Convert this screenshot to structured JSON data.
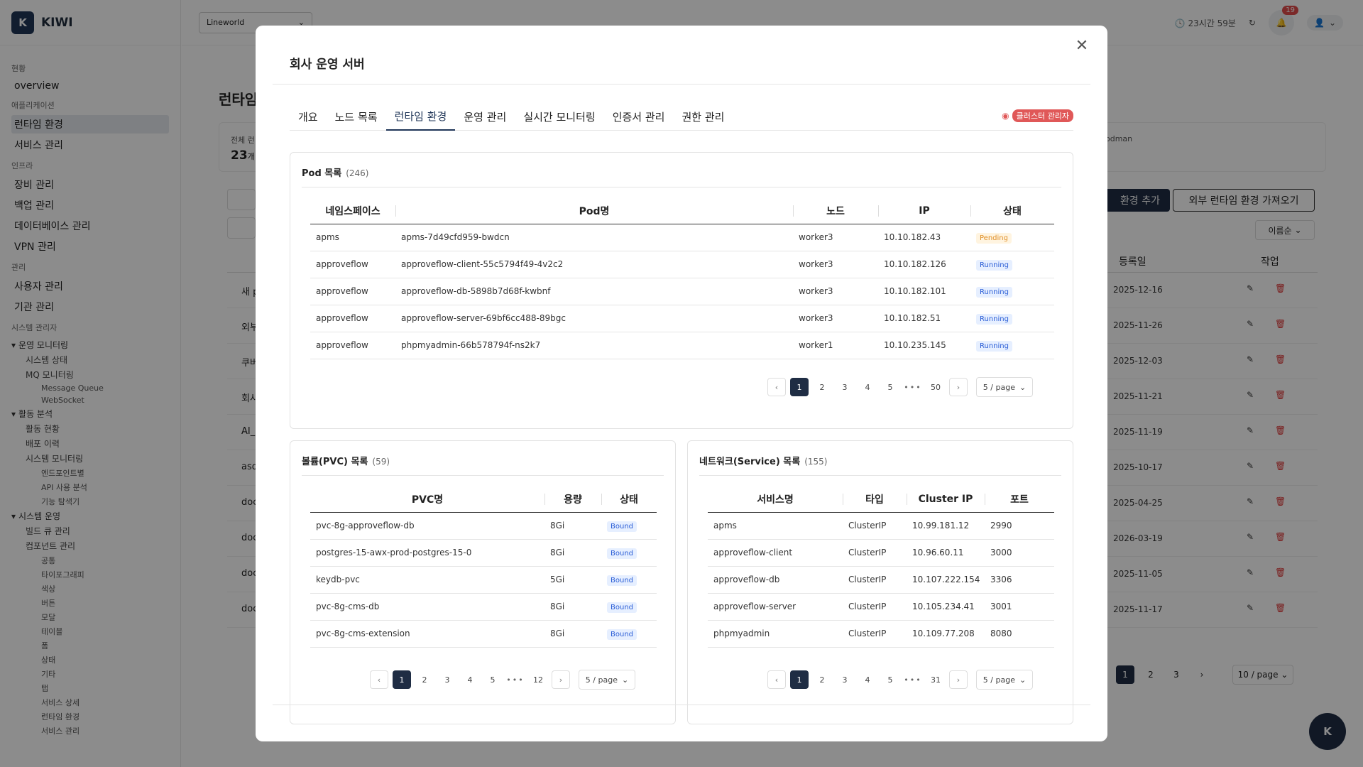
{
  "app": {
    "logo_letter": "K",
    "logo_text": "KIWI",
    "project_select": "Lineworld",
    "session_timer": "23시간 59분",
    "notification_count": "19",
    "page_title": "런타임",
    "stat_label": "전체 런",
    "stat_value": "23",
    "stat_unit": "개",
    "stat_right_text": "odman",
    "add_button": "환경 추가",
    "import_button": "외부 런타임 환경 가져오기",
    "sort_label": "이름순",
    "col_registered": "등록일",
    "col_actions": "작업",
    "fab_label": "K"
  },
  "sidebar": {
    "groups": [
      {
        "title": "현황",
        "items": [
          {
            "label": "overview"
          }
        ]
      },
      {
        "title": "애플리케이션",
        "items": [
          {
            "label": "런타임 환경",
            "active": true
          },
          {
            "label": "서비스 관리"
          }
        ]
      },
      {
        "title": "인프라",
        "items": [
          {
            "label": "장비 관리"
          },
          {
            "label": "백업 관리"
          },
          {
            "label": "데이터베이스 관리"
          },
          {
            "label": "VPN 관리"
          }
        ]
      },
      {
        "title": "관리",
        "items": [
          {
            "label": "사용자 관리"
          },
          {
            "label": "기관 관리"
          }
        ]
      },
      {
        "title": "시스템 관리자",
        "items": []
      }
    ],
    "tree": [
      {
        "label": "운영 모니터링",
        "level": 1
      },
      {
        "label": "시스템 상태",
        "level": 2
      },
      {
        "label": "MQ 모니터링",
        "level": 2
      },
      {
        "label": "Message Queue",
        "level": 3
      },
      {
        "label": "WebSocket",
        "level": 3
      },
      {
        "label": "활동 분석",
        "level": 1
      },
      {
        "label": "활동 현황",
        "level": 2
      },
      {
        "label": "배포 이력",
        "level": 2
      },
      {
        "label": "시스템 모니터링",
        "level": 2
      },
      {
        "label": "엔드포인트별",
        "level": 3
      },
      {
        "label": "API 사용 분석",
        "level": 3
      },
      {
        "label": "기능 탐색기",
        "level": 3
      },
      {
        "label": "시스템 운영",
        "level": 1
      },
      {
        "label": "빌드 큐 관리",
        "level": 2
      },
      {
        "label": "컴포넌트 관리",
        "level": 2
      },
      {
        "label": "공통",
        "level": 3
      },
      {
        "label": "타이포그래피",
        "level": 3
      },
      {
        "label": "색상",
        "level": 3
      },
      {
        "label": "버튼",
        "level": 3
      },
      {
        "label": "모달",
        "level": 3
      },
      {
        "label": "테이블",
        "level": 3
      },
      {
        "label": "폼",
        "level": 3
      },
      {
        "label": "상태",
        "level": 3
      },
      {
        "label": "기타",
        "level": 3
      },
      {
        "label": "탭",
        "level": 3
      },
      {
        "label": "서비스 상세",
        "level": 3
      },
      {
        "label": "런타임 환경",
        "level": 3
      },
      {
        "label": "서비스 관리",
        "level": 3
      }
    ]
  },
  "bg_rows": [
    {
      "name": "새 p",
      "date": "2025-12-16"
    },
    {
      "name": "외부",
      "date": "2025-11-26"
    },
    {
      "name": "쿠버",
      "date": "2025-12-03"
    },
    {
      "name": "회사",
      "date": "2025-11-21"
    },
    {
      "name": "AI_c",
      "date": "2025-11-19"
    },
    {
      "name": "asd",
      "date": "2025-10-17"
    },
    {
      "name": "doc",
      "date": "2025-04-25"
    },
    {
      "name": "doc",
      "date": "2026-03-19"
    },
    {
      "name": "doc",
      "date": "2025-11-05"
    },
    {
      "name": "doc",
      "date": "2025-11-17"
    }
  ],
  "bg_pager": {
    "pages": [
      "1",
      "2",
      "3"
    ],
    "size": "10 / page"
  },
  "modal": {
    "title": "회사 운영 서버",
    "tabs": [
      "개요",
      "노드 목록",
      "런타임 환경",
      "운영 관리",
      "실시간 모니터링",
      "인증서 관리",
      "권한 관리"
    ],
    "active_tab": 2,
    "role_badge": "클러스터 관리자"
  },
  "pods": {
    "title": "Pod 목록",
    "count": "(246)",
    "headers": [
      "네임스페이스",
      "Pod명",
      "노드",
      "IP",
      "상태"
    ],
    "rows": [
      {
        "ns": "apms",
        "name": "apms-7d49cfd959-bwdcn",
        "node": "worker3",
        "ip": "10.10.182.43",
        "status": "Pending"
      },
      {
        "ns": "approveflow",
        "name": "approveflow-client-55c5794f49-4v2c2",
        "node": "worker3",
        "ip": "10.10.182.126",
        "status": "Running"
      },
      {
        "ns": "approveflow",
        "name": "approveflow-db-5898b7d68f-kwbnf",
        "node": "worker3",
        "ip": "10.10.182.101",
        "status": "Running"
      },
      {
        "ns": "approveflow",
        "name": "approveflow-server-69bf6cc488-89bgc",
        "node": "worker3",
        "ip": "10.10.182.51",
        "status": "Running"
      },
      {
        "ns": "approveflow",
        "name": "phpmyadmin-66b578794f-ns2k7",
        "node": "worker1",
        "ip": "10.10.235.145",
        "status": "Running"
      }
    ],
    "pager": {
      "pages": [
        "1",
        "2",
        "3",
        "4",
        "5"
      ],
      "last": "50",
      "size": "5 / page"
    }
  },
  "pvcs": {
    "title": "볼륨(PVC) 목록",
    "count": "(59)",
    "headers": [
      "PVC명",
      "용량",
      "상태"
    ],
    "rows": [
      {
        "name": "pvc-8g-approveflow-db",
        "size": "8Gi",
        "status": "Bound"
      },
      {
        "name": "postgres-15-awx-prod-postgres-15-0",
        "size": "8Gi",
        "status": "Bound"
      },
      {
        "name": "keydb-pvc",
        "size": "5Gi",
        "status": "Bound"
      },
      {
        "name": "pvc-8g-cms-db",
        "size": "8Gi",
        "status": "Bound"
      },
      {
        "name": "pvc-8g-cms-extension",
        "size": "8Gi",
        "status": "Bound"
      }
    ],
    "pager": {
      "pages": [
        "1",
        "2",
        "3",
        "4",
        "5"
      ],
      "last": "12",
      "size": "5 / page"
    }
  },
  "services": {
    "title": "네트워크(Service) 목록",
    "count": "(155)",
    "headers": [
      "서비스명",
      "타입",
      "Cluster IP",
      "포트"
    ],
    "rows": [
      {
        "name": "apms",
        "type": "ClusterIP",
        "ip": "10.99.181.12",
        "port": "2990"
      },
      {
        "name": "approveflow-client",
        "type": "ClusterIP",
        "ip": "10.96.60.11",
        "port": "3000"
      },
      {
        "name": "approveflow-db",
        "type": "ClusterIP",
        "ip": "10.107.222.154",
        "port": "3306"
      },
      {
        "name": "approveflow-server",
        "type": "ClusterIP",
        "ip": "10.105.234.41",
        "port": "3001"
      },
      {
        "name": "phpmyadmin",
        "type": "ClusterIP",
        "ip": "10.109.77.208",
        "port": "8080"
      }
    ],
    "pager": {
      "pages": [
        "1",
        "2",
        "3",
        "4",
        "5"
      ],
      "last": "31",
      "size": "5 / page"
    }
  },
  "colors": {
    "primary": "#1f2d44",
    "danger": "#e05858",
    "pending": "#e0902a",
    "running": "#2a5dd6"
  }
}
